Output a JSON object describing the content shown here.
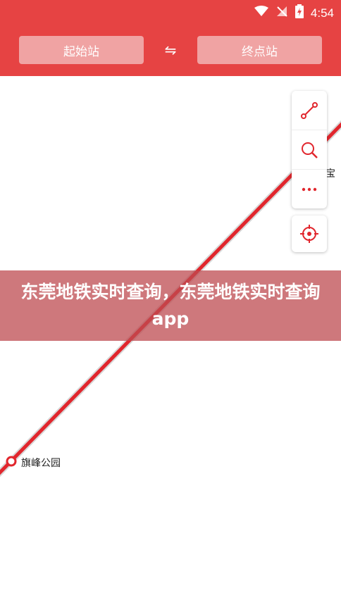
{
  "status": {
    "time": "4:54"
  },
  "header": {
    "start_label": "起始站",
    "swap_symbol": "⇋",
    "end_label": "终点站"
  },
  "map": {
    "line_color": "#e1262d",
    "stations": [
      {
        "label": "旗峰公园"
      },
      {
        "label": "宝"
      }
    ]
  },
  "tools": {
    "route_icon": "route-icon",
    "search_icon": "search-icon",
    "more_icon": "more-icon",
    "locate_icon": "locate-icon"
  },
  "banner": {
    "text": "东莞地铁实时查询，东莞地铁实时查询app"
  }
}
